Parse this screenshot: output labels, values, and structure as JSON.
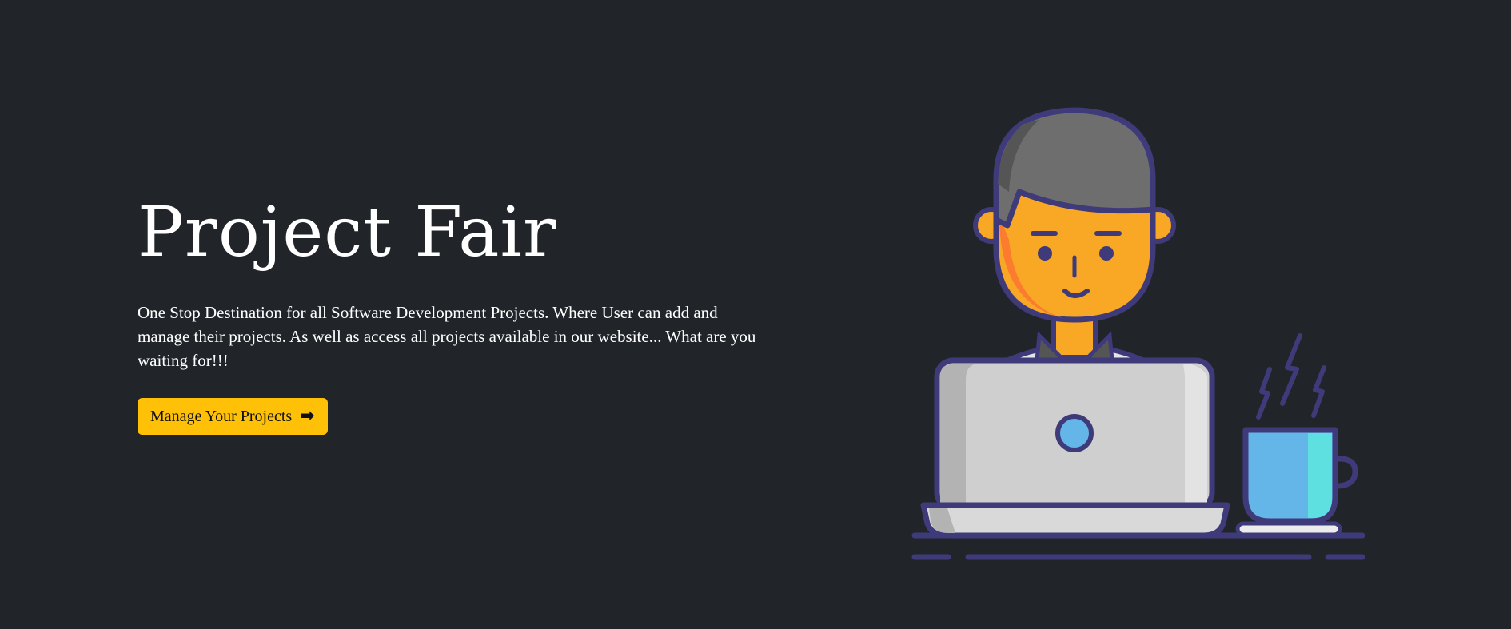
{
  "hero": {
    "title": "Project Fair",
    "description": "One Stop Destination for all Software Development Projects. Where User can add and manage their projects. As well as access all projects available in our website... What are you waiting for!!!",
    "cta_label": "Manage Your Projects",
    "cta_icon": "arrow-right-icon",
    "illustration": "developer-at-laptop-illustration"
  },
  "colors": {
    "background": "#212529",
    "accent": "#ffc107",
    "text": "#ffffff"
  }
}
